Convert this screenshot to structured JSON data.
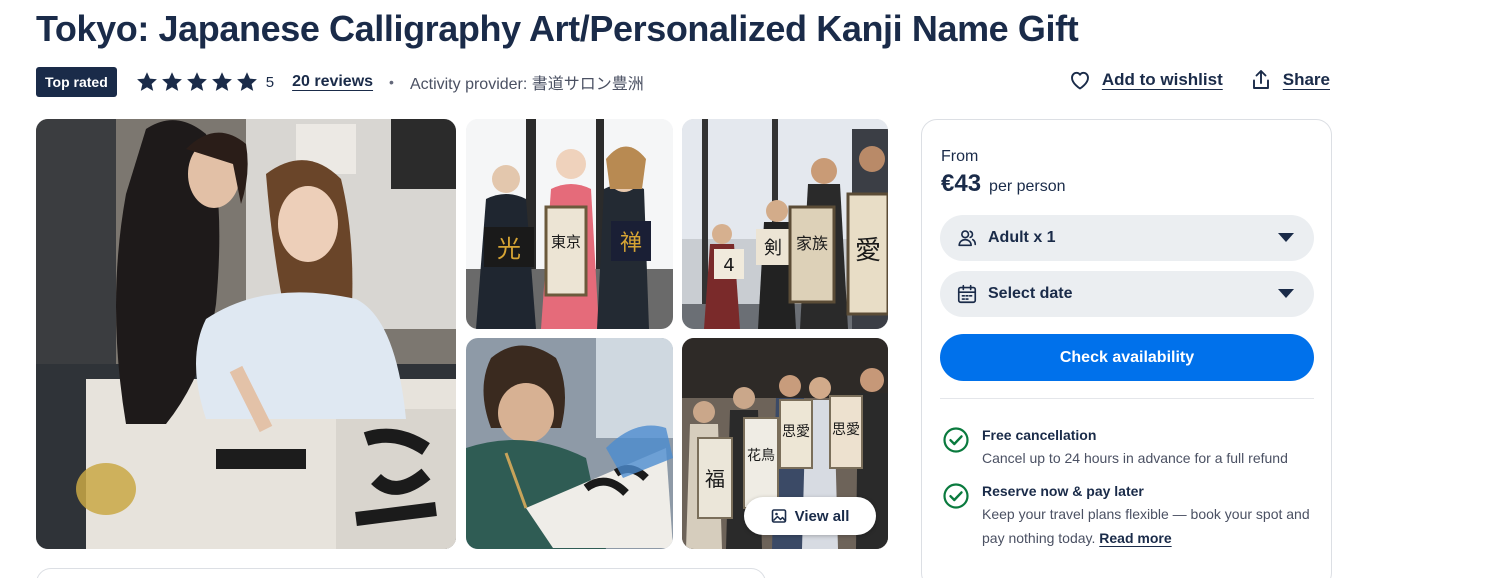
{
  "page": {
    "title": "Tokyo: Japanese Calligraphy Art/Personalized Kanji Name Gift"
  },
  "meta": {
    "badge": "Top rated",
    "rating": "5",
    "stars": 5,
    "reviews_label": "20 reviews",
    "separator": "•",
    "provider": "Activity provider: 書道サロン豊洲"
  },
  "actions": {
    "wishlist_label": "Add to wishlist",
    "share_label": "Share"
  },
  "gallery": {
    "view_all_label": "View all",
    "scroll_kanji_a": [
      "光",
      "東京",
      "禅"
    ],
    "scroll_kanji_b": [
      "4",
      "剣",
      "家族",
      "愛"
    ],
    "scroll_kanji_d": [
      "福",
      "花鳥",
      "思愛",
      "思愛"
    ]
  },
  "booking": {
    "from_label": "From",
    "price": "€43",
    "per_label": "per person",
    "participants_value": "Adult x 1",
    "date_placeholder": "Select date",
    "check_button": "Check availability"
  },
  "features": [
    {
      "title": "Free cancellation",
      "desc": "Cancel up to 24 hours in advance for a full refund"
    },
    {
      "title": "Reserve now & pay later",
      "desc": "Keep your travel plans flexible — book your spot and pay nothing today.",
      "link": "Read more"
    }
  ],
  "colors": {
    "navy": "#1a2b49",
    "primary_blue": "#0071eb",
    "check_green": "#0a7a3e",
    "select_bg": "#ebeef1"
  }
}
